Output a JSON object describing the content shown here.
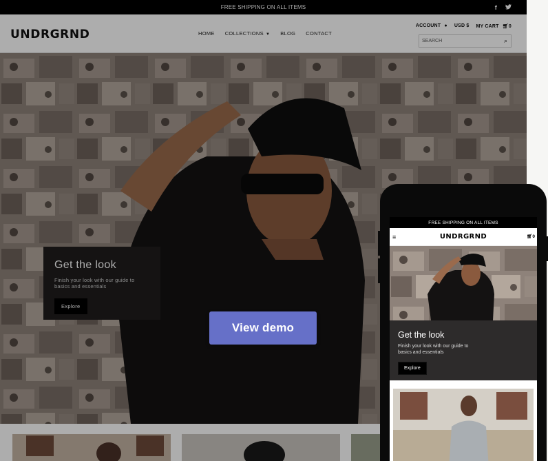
{
  "desktop": {
    "announcement": "FREE SHIPPING ON ALL ITEMS",
    "social": [
      "facebook-icon",
      "twitter-icon"
    ],
    "logo": "UNDRGRND",
    "nav": {
      "home": "HOME",
      "collections": "COLLECTIONS",
      "blog": "BLOG",
      "contact": "CONTACT"
    },
    "util": {
      "account": "ACCOUNT",
      "currency": "USD $",
      "cart": "MY CART",
      "cart_count": "0"
    },
    "search_placeholder": "SEARCH",
    "hero_card": {
      "title": "Get the look",
      "text": "Finish your look with our guide to basics and essentials",
      "button": "Explore"
    }
  },
  "overlay_button": "View demo",
  "mobile": {
    "announcement": "FREE SHIPPING ON ALL ITEMS",
    "logo": "UNDRGRND",
    "cart_count": "0",
    "hero_card": {
      "title": "Get the look",
      "text": "Finish your look with our guide to basics and essentials",
      "button": "Explore"
    }
  },
  "colors": {
    "demo_button": "#6670c8",
    "card_bg": "#1f1d1d",
    "announcement_bg": "#000000"
  }
}
